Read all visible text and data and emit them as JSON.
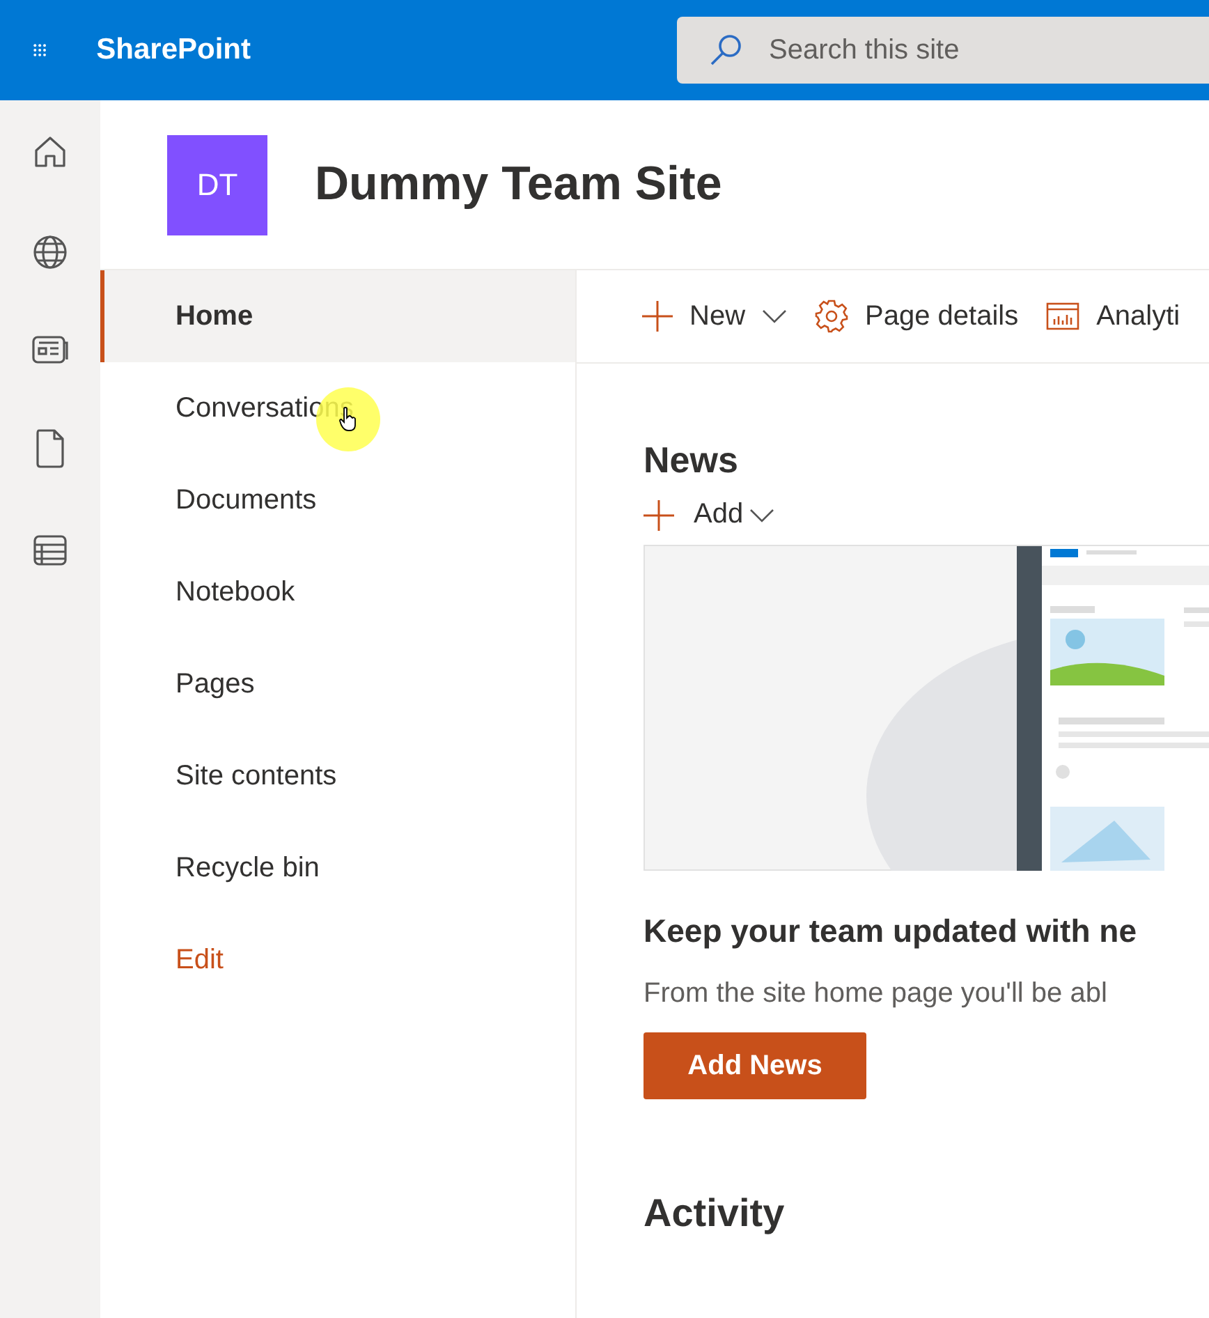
{
  "top_bar": {
    "app_name": "SharePoint",
    "search": {
      "placeholder": "Search this site"
    }
  },
  "site": {
    "logo_initials": "DT",
    "title": "Dummy Team Site"
  },
  "navigation": [
    {
      "label": "Home",
      "selected": true,
      "kind": "page"
    },
    {
      "label": "Conversations",
      "selected": false,
      "kind": "page"
    },
    {
      "label": "Documents",
      "selected": false,
      "kind": "page"
    },
    {
      "label": "Notebook",
      "selected": false,
      "kind": "page"
    },
    {
      "label": "Pages",
      "selected": false,
      "kind": "page"
    },
    {
      "label": "Site contents",
      "selected": false,
      "kind": "page"
    },
    {
      "label": "Recycle bin",
      "selected": false,
      "kind": "page"
    },
    {
      "label": "Edit",
      "selected": false,
      "kind": "action"
    }
  ],
  "command_bar": [
    {
      "label": "New",
      "kind": "new"
    },
    {
      "label": "Page details",
      "kind": "details"
    },
    {
      "label": "Analyti",
      "kind": "analytics"
    }
  ],
  "news": {
    "heading": "News",
    "add_label": "Add",
    "empty_title": "Keep your team updated with ne",
    "empty_text": "From the site home page you'll be abl",
    "button": "Add News"
  },
  "activity": {
    "heading": "Activity"
  }
}
